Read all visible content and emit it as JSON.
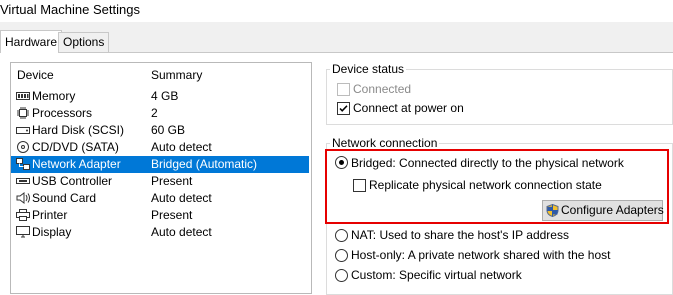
{
  "window": {
    "title": "Virtual Machine Settings"
  },
  "tabs": [
    {
      "label": "Hardware"
    },
    {
      "label": "Options"
    }
  ],
  "device_list": {
    "headers": {
      "device": "Device",
      "summary": "Summary"
    },
    "rows": [
      {
        "device": "Memory",
        "summary": "4 GB",
        "icon": "memory-icon"
      },
      {
        "device": "Processors",
        "summary": "2",
        "icon": "processor-icon"
      },
      {
        "device": "Hard Disk (SCSI)",
        "summary": "60 GB",
        "icon": "hard-disk-icon"
      },
      {
        "device": "CD/DVD (SATA)",
        "summary": "Auto detect",
        "icon": "cd-dvd-icon"
      },
      {
        "device": "Network Adapter",
        "summary": "Bridged (Automatic)",
        "icon": "network-adapter-icon",
        "selected": true
      },
      {
        "device": "USB Controller",
        "summary": "Present",
        "icon": "usb-icon"
      },
      {
        "device": "Sound Card",
        "summary": "Auto detect",
        "icon": "speaker-icon"
      },
      {
        "device": "Printer",
        "summary": "Present",
        "icon": "printer-icon"
      },
      {
        "device": "Display",
        "summary": "Auto detect",
        "icon": "display-icon"
      }
    ]
  },
  "device_status": {
    "label": "Device status",
    "connected": {
      "label": "Connected",
      "checked": false,
      "enabled": false
    },
    "connect_at_power_on": {
      "label": "Connect at power on",
      "checked": true
    }
  },
  "network_connection": {
    "label": "Network connection",
    "bridged": {
      "label": "Bridged: Connected directly to the physical network",
      "selected": true
    },
    "replicate": {
      "label": "Replicate physical network connection state",
      "checked": false
    },
    "configure_button": {
      "label": "Configure Adapters"
    },
    "nat": {
      "label": "NAT: Used to share the host's IP address"
    },
    "host_only": {
      "label": "Host-only: A private network shared with the host"
    },
    "custom": {
      "label": "Custom: Specific virtual network"
    }
  },
  "colors": {
    "selection": "#0078d7",
    "highlight_border": "#e60000"
  }
}
